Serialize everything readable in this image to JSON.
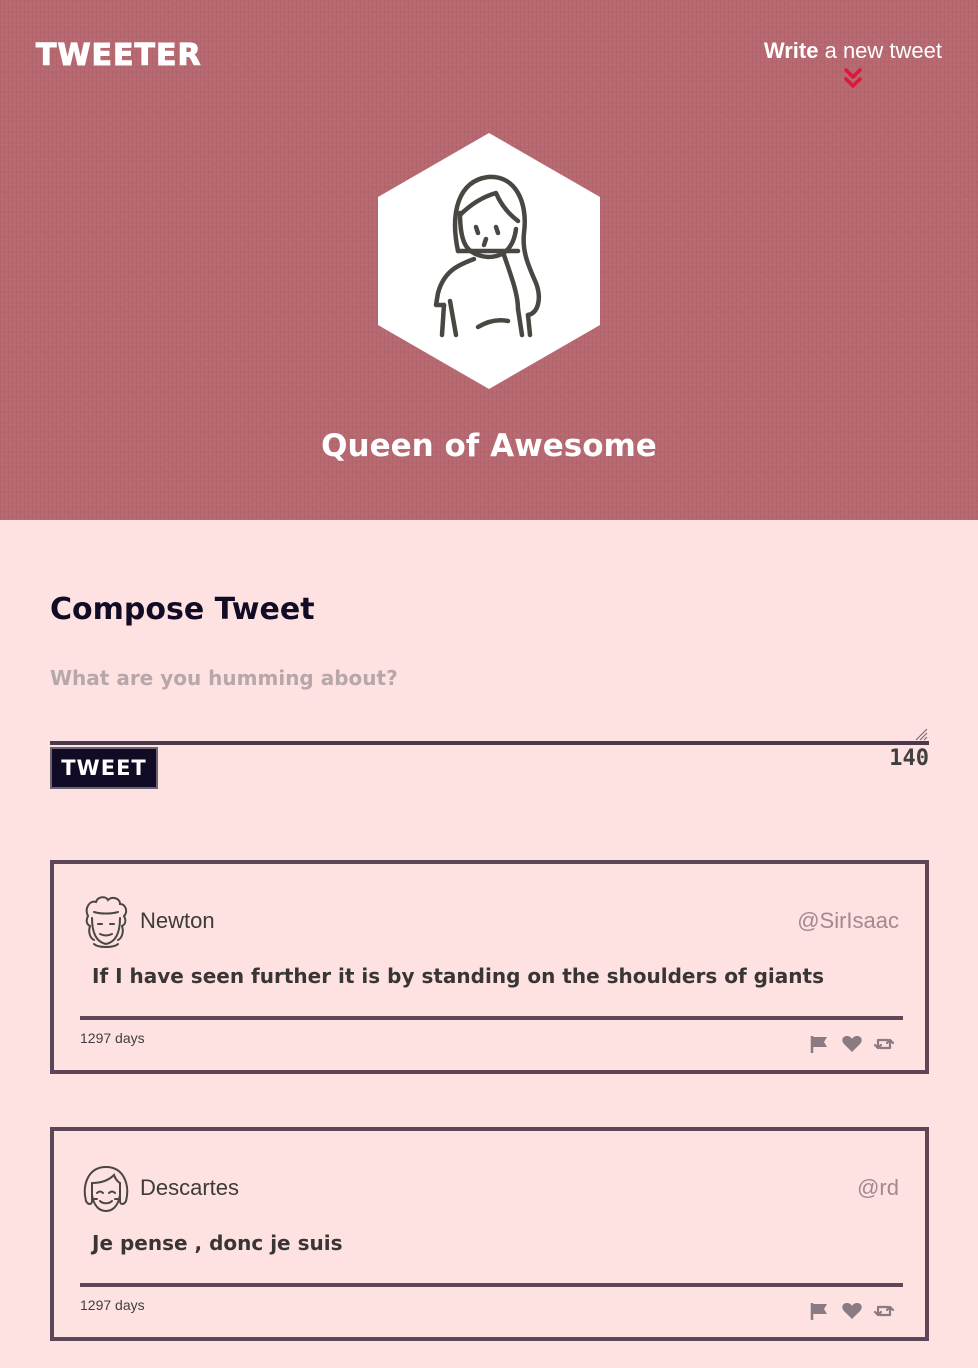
{
  "header": {
    "brand": "TWEETER",
    "write_link": {
      "strong": "Write",
      "rest": " a new tweet"
    },
    "profile_name": "Queen of Awesome",
    "accent_color": "#e0153a",
    "bg_color": "#b86870"
  },
  "compose": {
    "title": "Compose Tweet",
    "placeholder": "What are you humming about?",
    "value": "",
    "button_label": "TWEET",
    "counter": "140"
  },
  "tweets": [
    {
      "name": "Newton",
      "handle": "@SirIsaac",
      "text": "If I have seen further it is by standing on the shoulders of giants",
      "age": "1297 days",
      "avatar_icon": "curly-hair-face-icon"
    },
    {
      "name": "Descartes",
      "handle": "@rd",
      "text": "Je pense , donc je suis",
      "age": "1297 days",
      "avatar_icon": "bob-hair-face-icon"
    }
  ],
  "actions": [
    "flag-icon",
    "heart-icon",
    "retweet-icon"
  ],
  "colors": {
    "page_bg": "#fde2e1",
    "dark": "#120b26",
    "border": "#5c4657"
  }
}
